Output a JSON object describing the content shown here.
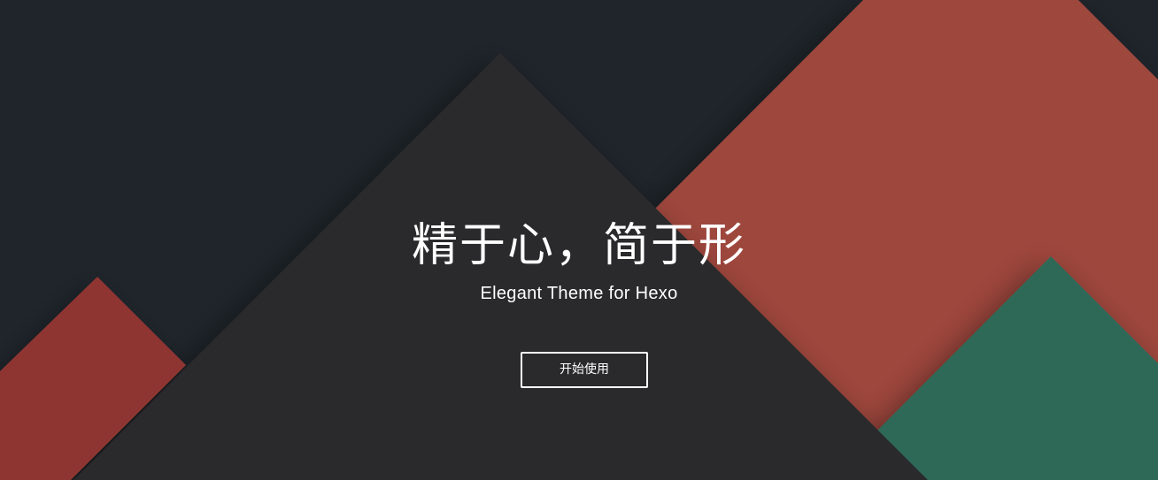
{
  "hero": {
    "title": "精于心，简于形",
    "subtitle": "Elegant Theme for Hexo",
    "cta_label": "开始使用"
  },
  "colors": {
    "background": "#1f252b",
    "dark_triangle": "#2a2a2c",
    "red_accent": "#9e463e",
    "red_left": "#8e3632",
    "green_accent": "#2f6959",
    "text": "#ffffff"
  }
}
